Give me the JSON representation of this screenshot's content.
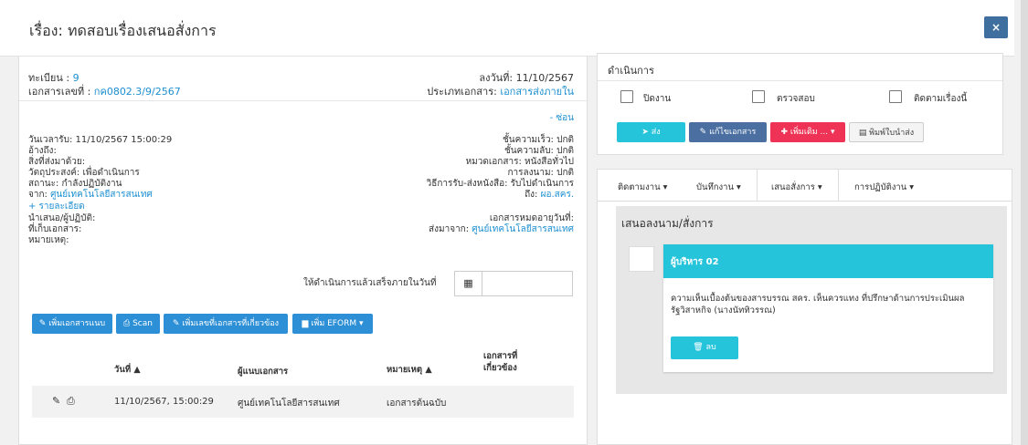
{
  "modal": {
    "title": "เรื่อง: ทดสอบเรื่องเสนอสั่งการ",
    "close_label": "×"
  },
  "doc": {
    "reg_label": "ทะเบียน : ",
    "reg_value": "9",
    "docno_label": "เอกสารเลขที่ : ",
    "docno_value": "กค0802.3/9/2567",
    "date": "ลงวันที่: 11/10/2567",
    "type_label": "ประเภทเอกสาร: ",
    "type_value": "เอกสารส่งภายใน",
    "hide_link": "- ซ่อน",
    "received": "วันเวลารับ: 11/10/2567 15:00:29",
    "ref": "อ้างถึง:",
    "enclosed": "สิ่งที่ส่งมาด้วย:",
    "purpose": "วัตถุประสงค์: เพื่อดำเนินการ",
    "status": "สถานะ: กำลังปฏิบัติงาน",
    "from_label": "จาก: ",
    "from_value": "ศูนย์เทคโนโลยีสารสนเทศ",
    "more_link": "+ รายละเอียด",
    "presenter": "นำเสนอ/ผู้ปฏิบัติ:",
    "storage": "ที่เก็บเอกสาร:",
    "note": "หมายเหตุ:",
    "urgency": "ชั้นความเร็ว: ปกติ",
    "secrecy": "ชั้นความลับ: ปกติ",
    "category": "หมวดเอกสาร: หนังสือทั่วไป",
    "signing": "การลงนาม: ปกติ",
    "method": "วิธีการรับ-ส่งหนังสือ: รับไปดำเนินการ",
    "to_label": "ถึง: ",
    "to_value": "ผอ.สคร.",
    "expire": "เอกสารหมดอายุวันที่:",
    "sentfrom_label": "ส่งมาจาก: ",
    "sentfrom_value": "ศูนย์เทคโนโลยีสารสนเทศ",
    "deadline_label": "ให้ดำเนินการแล้วเสร็จภายในวันที่"
  },
  "toolbar": {
    "attach": "✎ เพิ่มเอกสารแนบ",
    "scan": "⎙ Scan",
    "related": "✎ เพิ่มเลขที่เอกสารที่เกี่ยวข้อง",
    "eform": "▆ เพิ่ม EFORM ▾"
  },
  "table": {
    "headers": [
      "วันที่ ▲",
      "ผู้แนบเอกสาร",
      "หมายเหตุ ▲",
      "เอกสารที่เกี่ยวข้อง"
    ],
    "rows": [
      {
        "date": "11/10/2567, 15:00:29",
        "by": "ศูนย์เทคโนโลยีสารสนเทศ",
        "note": "เอกสารต้นฉบับ",
        "related": ""
      }
    ]
  },
  "action": {
    "title": "ดำเนินการ",
    "checkboxes": [
      "ปิดงาน",
      "ตรวจสอบ",
      "ติดตามเรื่องนี้"
    ],
    "send": "➤ ส่ง",
    "edit": "✎ แก้ไขเอกสาร",
    "add": "✚ เพิ่มเติม ... ▾",
    "print": "▤ พิมพ์ใบนำส่ง"
  },
  "tabs": {
    "items": [
      "ติดตามงาน ▾",
      "บันทึกงาน ▾",
      "เสนอสั่งการ ▾",
      "การปฏิบัติงาน ▾"
    ],
    "heading": "เสนอลงนาม/สั่งการ",
    "comment_author": "ผู้บริหาร 02",
    "comment_text_1": "ความเห็นเบื้องต้นของสารบรรณ สคร. เห็นควรแทง ที่ปรึกษาด้านการประเมินผล",
    "comment_text_2": "รัฐวิสาหกิจ (นางนัททิวรรณ)",
    "delete_label": "🗑 ลบ"
  },
  "colors": {
    "primary": "#2d8fd5",
    "cyan": "#26c4db",
    "steel": "#4a6fa0",
    "pink": "#ef3356"
  }
}
